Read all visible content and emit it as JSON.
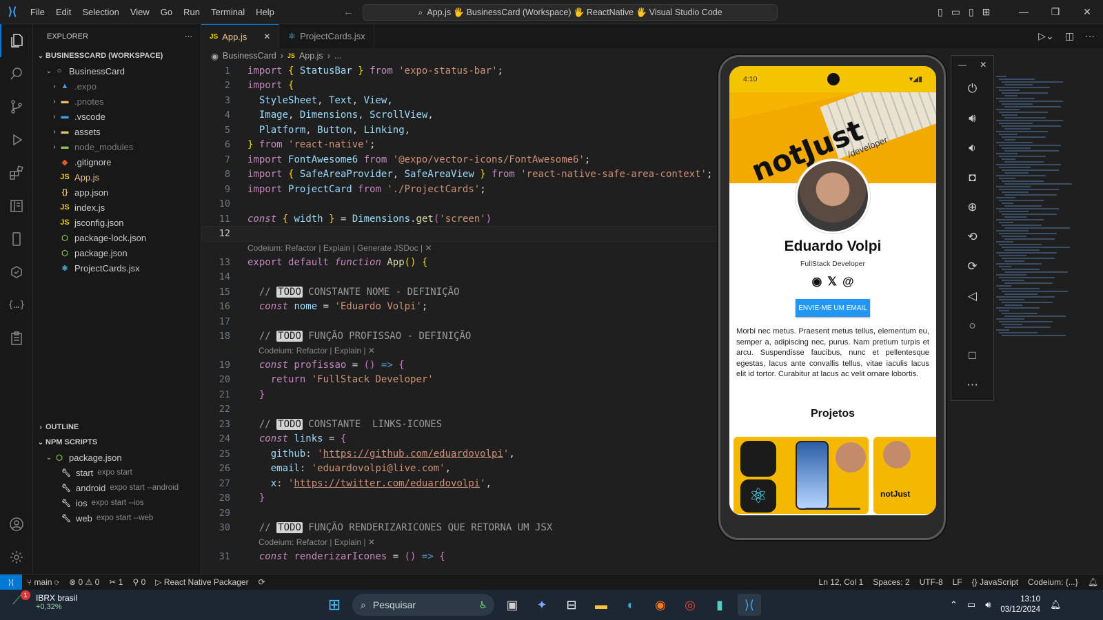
{
  "titlebar": {
    "menu": [
      "File",
      "Edit",
      "Selection",
      "View",
      "Go",
      "Run",
      "Terminal",
      "Help"
    ],
    "command_center": "App.js 🖐 BusinessCard (Workspace) 🖐 ReactNative 🖐 Visual Studio Code"
  },
  "sidebar": {
    "title": "EXPLORER",
    "workspace": "BUSINESSCARD (WORKSPACE)",
    "root": "BusinessCard",
    "items": [
      {
        "label": ".expo",
        "muted": true,
        "folder": true,
        "icon": "▲",
        "color": "#4a9cf0"
      },
      {
        "label": ".pnotes",
        "muted": true,
        "folder": true,
        "icon": "▬",
        "color": "#e8c16b"
      },
      {
        "label": ".vscode",
        "muted": false,
        "folder": true,
        "icon": "▬",
        "color": "#3ea6ff"
      },
      {
        "label": "assets",
        "muted": false,
        "folder": true,
        "icon": "▬",
        "color": "#e8c16b"
      },
      {
        "label": "node_modules",
        "muted": true,
        "folder": true,
        "icon": "▬",
        "color": "#8bc34a"
      },
      {
        "label": ".gitignore",
        "muted": false,
        "folder": false,
        "icon": "◆",
        "color": "#e2572c"
      },
      {
        "label": "App.js",
        "muted": false,
        "folder": false,
        "icon": "JS",
        "color": "#f0d000",
        "selected": true
      },
      {
        "label": "app.json",
        "muted": false,
        "folder": false,
        "icon": "{}",
        "color": "#e8c16b"
      },
      {
        "label": "index.js",
        "muted": false,
        "folder": false,
        "icon": "JS",
        "color": "#f0d000"
      },
      {
        "label": "jsconfig.json",
        "muted": false,
        "folder": false,
        "icon": "JS",
        "color": "#f0d000"
      },
      {
        "label": "package-lock.json",
        "muted": false,
        "folder": false,
        "icon": "⬡",
        "color": "#8bc34a"
      },
      {
        "label": "package.json",
        "muted": false,
        "folder": false,
        "icon": "⬡",
        "color": "#8bc34a"
      },
      {
        "label": "ProjectCards.jsx",
        "muted": false,
        "folder": false,
        "icon": "⚛",
        "color": "#4fc3f7"
      }
    ],
    "outline": "OUTLINE",
    "npm_scripts": "NPM SCRIPTS",
    "npm_package": "package.json",
    "scripts": [
      {
        "name": "start",
        "cmd": "expo start"
      },
      {
        "name": "android",
        "cmd": "expo start --android"
      },
      {
        "name": "ios",
        "cmd": "expo start --ios"
      },
      {
        "name": "web",
        "cmd": "expo start --web"
      }
    ]
  },
  "tabs": [
    {
      "label": "App.js",
      "icon": "JS",
      "active": true
    },
    {
      "label": "ProjectCards.jsx",
      "icon": "⚛",
      "active": false
    }
  ],
  "breadcrumb": [
    "BusinessCard",
    "App.js",
    "..."
  ],
  "code_lens": {
    "fn": "Codeium: Refactor | Explain | Generate JSDoc | ✕",
    "short": "Codeium: Refactor | Explain | ✕"
  },
  "phone": {
    "status_time": "4:10",
    "cover_text": "notJust",
    "cover_sub": "/developer",
    "name": "Eduardo Volpi",
    "role": "FullStack Developer",
    "email_button": "ENVIE-ME UM EMAIL",
    "bio": "Morbi nec metus. Praesent metus tellus, elementum eu, semper a, adipiscing nec, purus. Nam pretium turpis et arcu. Suspendisse faucibus, nunc et pellentesque egestas, lacus ante convallis tellus, vitae iaculis lacus elit id tortor. Curabitur at lacus ac velit ornare lobortis.",
    "projects_title": "Projetos",
    "project2_label": "notJust"
  },
  "statusbar": {
    "branch": "main",
    "errors": "0",
    "warnings": "0",
    "tools": "1",
    "ports": "0",
    "packager": "React Native Packager",
    "position": "Ln 12, Col 1",
    "spaces": "Spaces: 2",
    "encoding": "UTF-8",
    "eol": "LF",
    "language": "JavaScript",
    "codeium": "Codeium: {...}"
  },
  "taskbar": {
    "widget_title": "IBRX brasil",
    "widget_value": "+0,32%",
    "widget_badge": "1",
    "search_placeholder": "Pesquisar",
    "time": "13:10",
    "date": "03/12/2024"
  }
}
